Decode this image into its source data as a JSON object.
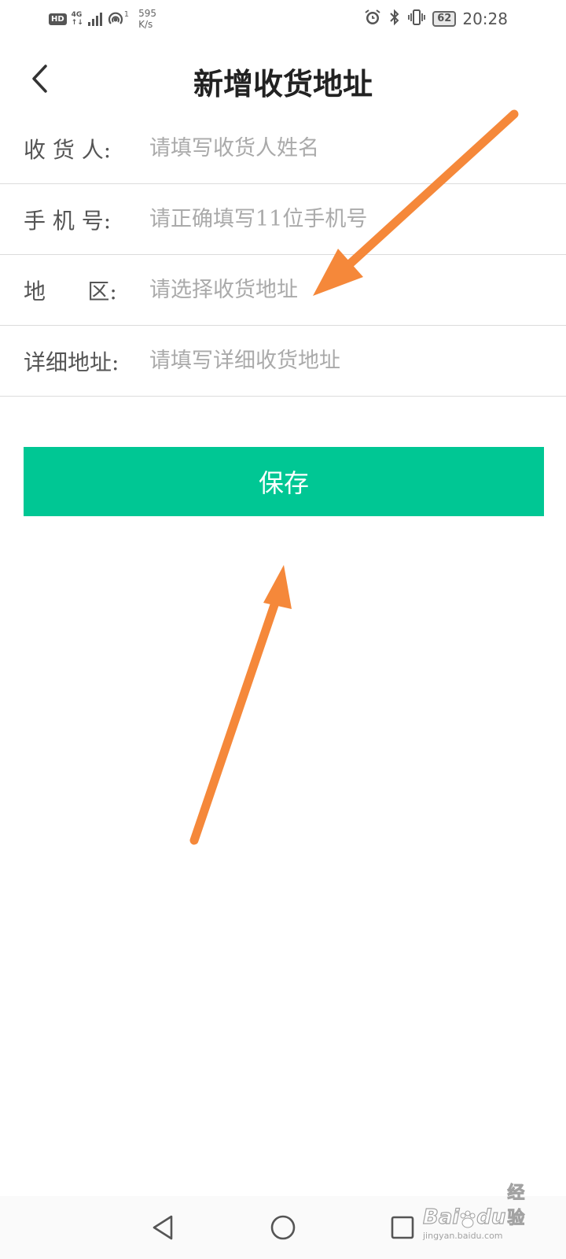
{
  "status_bar": {
    "hd": "HD",
    "network": "4G",
    "network_sub": "↑↓",
    "hotspot_count": "1",
    "speed_value": "595",
    "speed_unit": "K/s",
    "battery": "62",
    "time": "20:28"
  },
  "header": {
    "title": "新增收货地址"
  },
  "form": {
    "rows": [
      {
        "label": "收 货 人:",
        "placeholder": "请填写收货人姓名"
      },
      {
        "label": "手 机 号:",
        "placeholder": "请正确填写11位手机号"
      },
      {
        "label": "地      区:",
        "placeholder": "请选择收货地址"
      },
      {
        "label": "详细地址:",
        "placeholder": "请填写详细收货地址"
      }
    ]
  },
  "save_button": {
    "label": "保存",
    "color": "#00c794"
  },
  "annotation": {
    "arrow_color": "#f5883a"
  },
  "watermark": {
    "brand": "Bai",
    "brand2": "du",
    "suffix": "经验",
    "url": "jingyan.baidu.com"
  }
}
